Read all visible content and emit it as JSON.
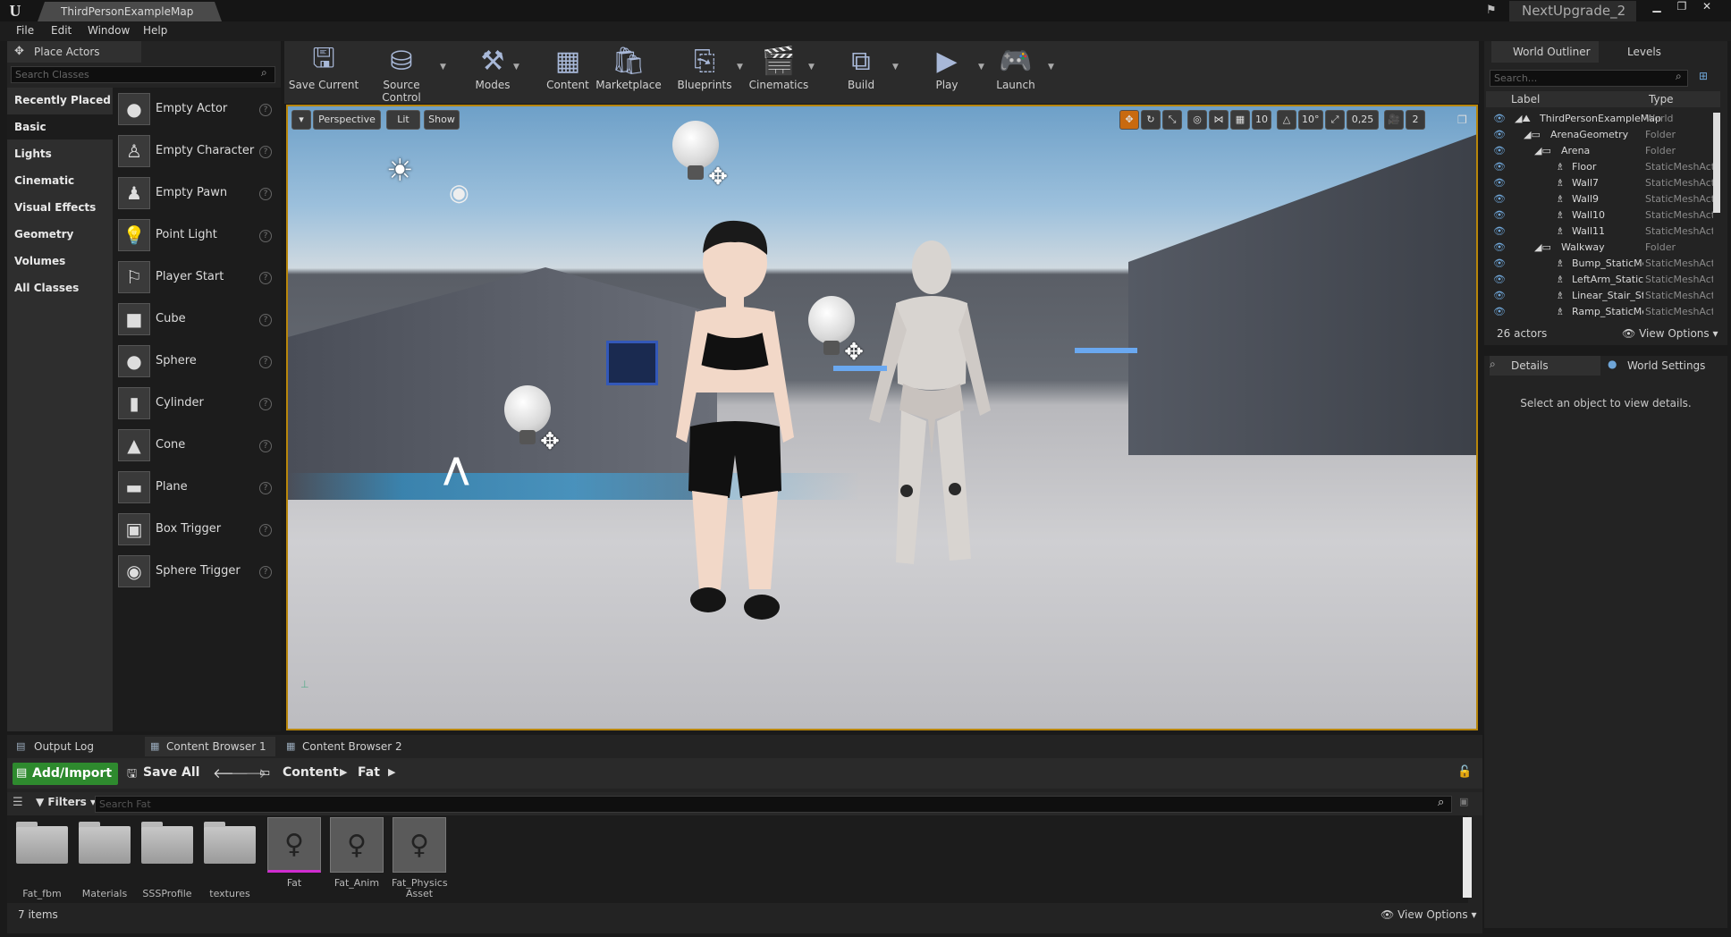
{
  "window": {
    "map_tab": "ThirdPersonExampleMap",
    "project": "NextUpgrade_2"
  },
  "menu": [
    "File",
    "Edit",
    "Window",
    "Help"
  ],
  "place_actors": {
    "title": "Place Actors",
    "search_placeholder": "Search Classes",
    "categories": [
      "Recently Placed",
      "Basic",
      "Lights",
      "Cinematic",
      "Visual Effects",
      "Geometry",
      "Volumes",
      "All Classes"
    ],
    "selected_category": "Basic",
    "actors": [
      "Empty Actor",
      "Empty Character",
      "Empty Pawn",
      "Point Light",
      "Player Start",
      "Cube",
      "Sphere",
      "Cylinder",
      "Cone",
      "Plane",
      "Box Trigger",
      "Sphere Trigger"
    ]
  },
  "toolbar": {
    "buttons": [
      "Save Current",
      "Source Control",
      "Modes",
      "Content",
      "Marketplace",
      "Blueprints",
      "Cinematics",
      "Build",
      "Play",
      "Launch"
    ]
  },
  "viewport": {
    "perspective": "Perspective",
    "lit": "Lit",
    "show": "Show",
    "grid_snap": "10",
    "rotation_snap": "10°",
    "scale_snap": "0,25",
    "camera_speed": "2"
  },
  "world_outliner": {
    "tab": "World Outliner",
    "levels_tab": "Levels",
    "search_placeholder": "Search...",
    "col_label": "Label",
    "col_type": "Type",
    "rows": [
      {
        "label": "ThirdPersonExampleMap",
        "type": "World"
      },
      {
        "label": "ArenaGeometry",
        "type": "Folder"
      },
      {
        "label": "Arena",
        "type": "Folder"
      },
      {
        "label": "Floor",
        "type": "StaticMeshActor"
      },
      {
        "label": "Wall7",
        "type": "StaticMeshActor"
      },
      {
        "label": "Wall9",
        "type": "StaticMeshActor"
      },
      {
        "label": "Wall10",
        "type": "StaticMeshActor"
      },
      {
        "label": "Wall11",
        "type": "StaticMeshActor"
      },
      {
        "label": "Walkway",
        "type": "Folder"
      },
      {
        "label": "Bump_StaticMesh",
        "type": "StaticMeshActor"
      },
      {
        "label": "LeftArm_StaticMesh",
        "type": "StaticMeshActor"
      },
      {
        "label": "Linear_Stair_StaticMesh",
        "type": "StaticMeshActor"
      },
      {
        "label": "Ramp_StaticMesh",
        "type": "StaticMeshActor"
      }
    ],
    "actor_count": "26 actors",
    "view_options": "View Options"
  },
  "details": {
    "tab": "Details",
    "world_settings_tab": "World Settings",
    "empty_message": "Select an object to view details."
  },
  "content_browser": {
    "tabs": [
      "Output Log",
      "Content Browser 1",
      "Content Browser 2"
    ],
    "add_import": "Add/Import",
    "save_all": "Save All",
    "path": [
      "Content",
      "Fat"
    ],
    "filters": "Filters",
    "search_placeholder": "Search Fat",
    "assets": [
      {
        "name": "Fat_fbm",
        "kind": "folder"
      },
      {
        "name": "Materials",
        "kind": "folder"
      },
      {
        "name": "SSSProfile",
        "kind": "folder"
      },
      {
        "name": "textures",
        "kind": "folder"
      },
      {
        "name": "Fat",
        "kind": "mesh"
      },
      {
        "name": "Fat_Anim",
        "kind": "mesh"
      },
      {
        "name": "Fat_Physics Asset",
        "kind": "mesh"
      }
    ],
    "item_count": "7 items",
    "view_options": "View Options"
  },
  "colors": {
    "accent_orange": "#b8860b",
    "add_green": "#2e8a2e",
    "eye_blue": "#6fa6d8"
  }
}
